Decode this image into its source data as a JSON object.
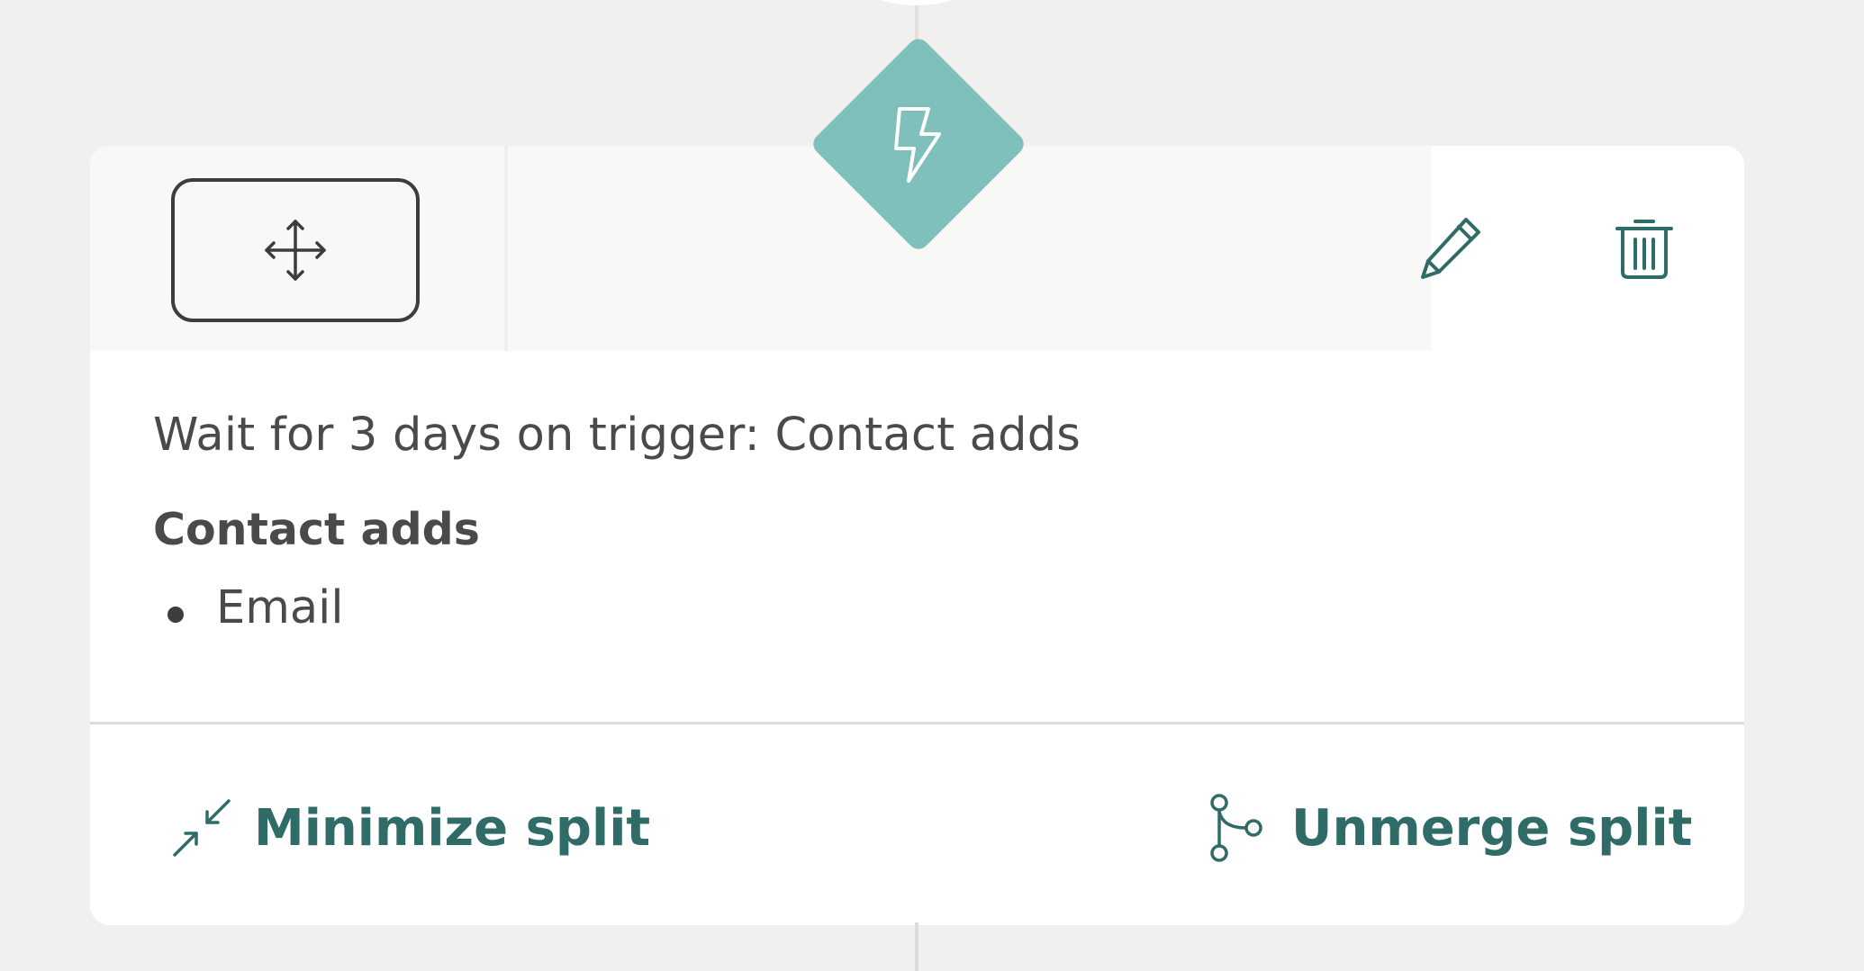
{
  "step": {
    "summary": "Wait for 3 days on trigger: Contact adds",
    "condition_heading": "Contact adds",
    "conditions": [
      "Email"
    ]
  },
  "header": {
    "move_icon": "move-arrows-icon",
    "edit_icon": "pencil-icon",
    "delete_icon": "trash-icon"
  },
  "trigger_node": {
    "icon": "lightning-bolt-icon",
    "color": "#7fbfbc"
  },
  "footer": {
    "minimize_label": "Minimize split",
    "minimize_icon": "minimize-arrows-icon",
    "unmerge_label": "Unmerge split",
    "unmerge_icon": "branch-icon"
  },
  "colors": {
    "accent": "#2f6b67",
    "diamond": "#7fbfbc",
    "text": "#4a4a4a",
    "background": "#f1f0ee"
  }
}
